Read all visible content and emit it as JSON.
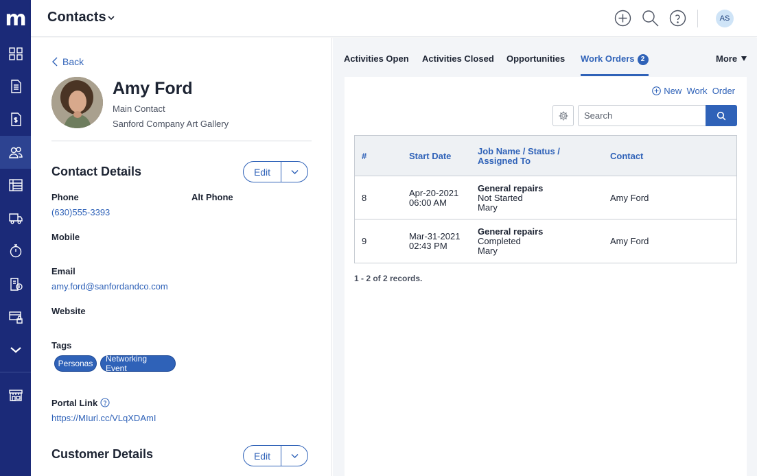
{
  "app": {
    "logo": "m",
    "title": "Contacts"
  },
  "header": {
    "avatar_initials": "AS"
  },
  "contact": {
    "back_label": "Back",
    "name": "Amy Ford",
    "role": "Main Contact",
    "company": "Sanford Company Art Gallery"
  },
  "contact_details": {
    "title": "Contact Details",
    "edit_label": "Edit",
    "phone_label": "Phone",
    "phone_value": "(630)555-3393",
    "alt_phone_label": "Alt Phone",
    "mobile_label": "Mobile",
    "email_label": "Email",
    "email_value": "amy.ford@sanfordandco.com",
    "website_label": "Website",
    "tags_label": "Tags",
    "tags": [
      "Personas",
      "Networking Event"
    ],
    "portal_label": "Portal Link",
    "portal_value": "https://MIurl.cc/VLqXDAmI"
  },
  "customer_details": {
    "title": "Customer Details",
    "edit_label": "Edit"
  },
  "tabs": [
    {
      "label": "Activities Open"
    },
    {
      "label": "Activities Closed"
    },
    {
      "label": "Opportunities"
    },
    {
      "label": "Work Orders",
      "badge": "2"
    },
    {
      "label": "More"
    }
  ],
  "work_orders": {
    "new_label": "New  Work  Order",
    "search_placeholder": "Search",
    "columns": [
      "#",
      "Start Date",
      "Job Name / Status /",
      "Assigned To",
      "Contact"
    ],
    "rows": [
      {
        "num": "8",
        "date": "Apr-20-2021",
        "time": "06:00 AM",
        "job": "General repairs",
        "status": "Not Started",
        "assigned": "Mary",
        "contact": "Amy Ford"
      },
      {
        "num": "9",
        "date": "Mar-31-2021",
        "time": "02:43 PM",
        "job": "General repairs",
        "status": "Completed",
        "assigned": "Mary",
        "contact": "Amy Ford"
      }
    ],
    "records_label": "1 - 2 of 2 records."
  },
  "colors": {
    "sidebar": "#1b2a78",
    "accent": "#2f62b8"
  },
  "icons": [
    "dashboard-icon",
    "document-icon",
    "invoice-icon",
    "contacts-icon",
    "list-icon",
    "truck-icon",
    "timer-icon",
    "billing-icon",
    "payment-lock-icon",
    "chevron-down-icon",
    "marketplace-icon",
    "plus-circle-icon",
    "search-icon",
    "help-icon",
    "gear-icon"
  ]
}
